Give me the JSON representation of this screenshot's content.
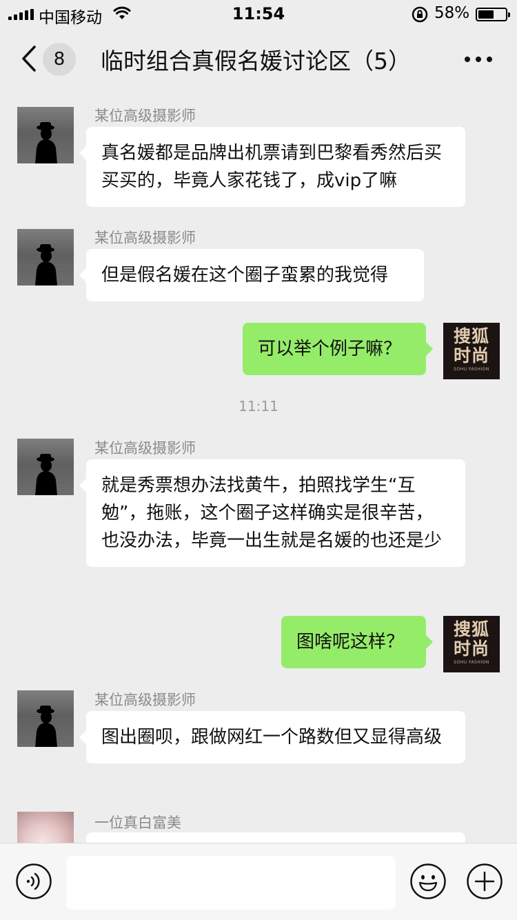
{
  "status_bar": {
    "carrier": "中国移动",
    "time": "11:54",
    "battery": "58%",
    "battery_level": 0.58
  },
  "nav": {
    "unread_count": "8",
    "title": "临时组合真假名媛讨论区（5）"
  },
  "brand_avatar": {
    "line1": "搜狐",
    "line2": "时尚",
    "sub": "SOHU FASHION"
  },
  "messages": [
    {
      "sender": "某位高级摄影师",
      "text": "真名媛都是品牌出机票请到巴黎看秀然后买买买的，毕竟人家花钱了，成vip了嘛"
    },
    {
      "sender": "某位高级摄影师",
      "text": "但是假名媛在这个圈子蛮累的我觉得"
    },
    {
      "text": "可以举个例子嘛？"
    },
    {
      "timestamp": "11:11"
    },
    {
      "sender": "某位高级摄影师",
      "text": "就是秀票想办法找黄牛，拍照找学生“互勉”，拖账，这个圈子这样确实是很辛苦，也没办法，毕竟一出生就是名媛的也还是少"
    },
    {
      "text": "图啥呢这样？"
    },
    {
      "sender": "某位高级摄影师",
      "text": "图出圈呗，跟做网红一个路数但又显得高级"
    },
    {
      "sender": "一位真白富美",
      "text": ""
    }
  ],
  "input": {
    "placeholder": ""
  },
  "icons": {
    "back": "chevron-left-icon",
    "more": "more-dots-icon",
    "voice": "voice-icon",
    "emoji": "emoji-icon",
    "plus": "plus-icon"
  }
}
